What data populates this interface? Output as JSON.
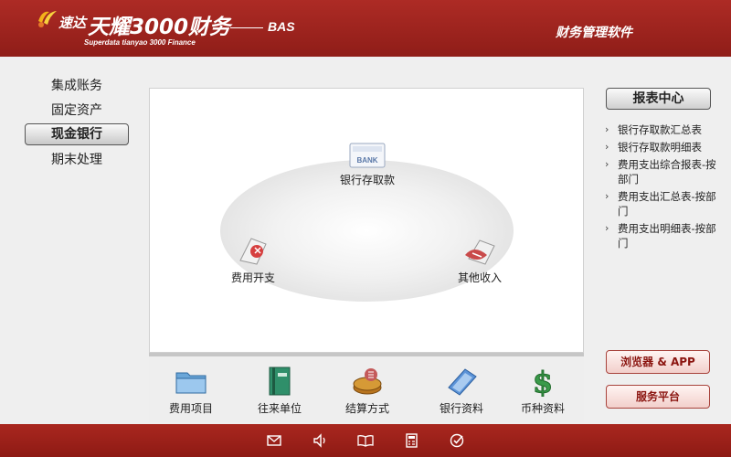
{
  "header": {
    "brand_small": "速达",
    "brand_big": "天耀3000财务",
    "brand_en": "Superdata tianyao 3000 Finance",
    "edition": "BAS",
    "product": "财务管理软件"
  },
  "nav": {
    "items": [
      {
        "label": "集成账务",
        "active": false
      },
      {
        "label": "固定资产",
        "active": false
      },
      {
        "label": "现金银行",
        "active": true
      },
      {
        "label": "期末处理",
        "active": false
      }
    ]
  },
  "flow": {
    "bank_label": "银行存取款",
    "bank_icon_text": "BANK",
    "expense_label": "费用开支",
    "income_label": "其他收入"
  },
  "tools": [
    {
      "label": "费用项目",
      "icon": "folder-icon"
    },
    {
      "label": "往来单位",
      "icon": "book-icon"
    },
    {
      "label": "结算方式",
      "icon": "coins-icon"
    },
    {
      "label": "银行资料",
      "icon": "notebook-icon"
    },
    {
      "label": "币种资料",
      "icon": "dollar-icon"
    }
  ],
  "reports": {
    "title": "报表中心",
    "items": [
      "银行存取款汇总表",
      "银行存取款明细表",
      "费用支出综合报表-按部门",
      "费用支出汇总表-按部门",
      "费用支出明细表-按部门"
    ]
  },
  "buttons": {
    "browser_app": "浏览器 & APP",
    "service": "服务平台"
  },
  "footer_icons": [
    "mail-icon",
    "speaker-icon",
    "open-book-icon",
    "calculator-icon",
    "check-icon"
  ],
  "colors": {
    "brand_red": "#9e231d",
    "button_text_red": "#8b1510"
  }
}
